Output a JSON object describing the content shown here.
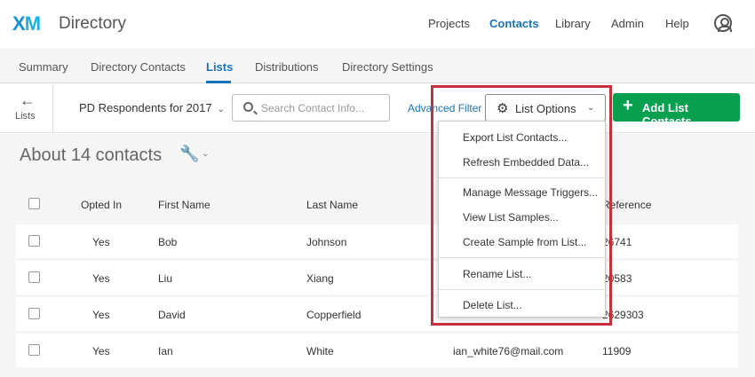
{
  "header": {
    "logo": "XM",
    "app_title": "Directory",
    "nav": [
      "Projects",
      "Contacts",
      "Library",
      "Admin",
      "Help"
    ],
    "active_nav": "Contacts"
  },
  "subnav": {
    "tabs": [
      "Summary",
      "Directory Contacts",
      "Lists",
      "Distributions",
      "Directory Settings"
    ],
    "active_tab": "Lists"
  },
  "toolbar": {
    "back_label": "Lists",
    "list_name": "PD Respondents for 2017",
    "search_placeholder": "Search Contact Info...",
    "advanced_filter": "Advanced Filter",
    "list_options": "List Options",
    "add_button": "Add List Contacts"
  },
  "main": {
    "count_title": "About 14 contacts"
  },
  "table": {
    "columns": [
      "Opted In",
      "First Name",
      "Last Name",
      "",
      "Reference"
    ],
    "rows": [
      {
        "opted": "Yes",
        "first": "Bob",
        "last": "Johnson",
        "email": "",
        "ref": "26741"
      },
      {
        "opted": "Yes",
        "first": "Liu",
        "last": "Xiang",
        "email": "",
        "ref": "20583"
      },
      {
        "opted": "Yes",
        "first": "David",
        "last": "Copperfield",
        "email": "",
        "ref": "2629303"
      },
      {
        "opted": "Yes",
        "first": "Ian",
        "last": "White",
        "email": "ian_white76@mail.com",
        "ref": "11909"
      }
    ]
  },
  "dropdown": {
    "items": [
      "Export List Contacts...",
      "Refresh Embedded Data...",
      "Manage Message Triggers...",
      "View List Samples...",
      "Create Sample from List...",
      "Rename List...",
      "Delete List..."
    ]
  },
  "colors": {
    "accent": "#1a73b8",
    "add_button": "#07a04f",
    "highlight": "#c7303b"
  },
  "icons": {
    "back": "arrow-left-icon",
    "search": "search-icon",
    "gear": "gear-icon",
    "plus": "plus-icon",
    "wrench": "wrench-icon",
    "profile": "user-icon"
  }
}
